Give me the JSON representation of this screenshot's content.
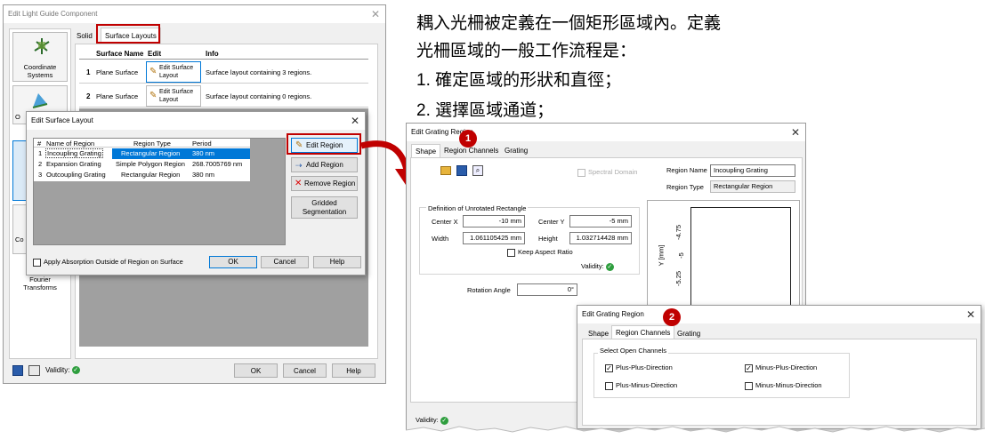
{
  "annotation": {
    "lines": [
      "耦入光柵被定義在一個矩形區域內。定義",
      "光柵區域的一般工作流程是：",
      "1. 確定區域的形狀和直徑；",
      "2. 選擇區域通道；"
    ],
    "badge1": "1",
    "badge2": "2"
  },
  "lgc": {
    "title": "Edit Light Guide Component",
    "sidebar": [
      "Coordinate Systems",
      "Fourier Transforms"
    ],
    "sidebar_partial": [
      "O",
      "Co"
    ],
    "tabs": [
      "Solid",
      "Surface Layouts"
    ],
    "table_headers": [
      "Surface Name",
      "Edit",
      "Info"
    ],
    "rows": [
      {
        "num": "1",
        "name": "Plane Surface",
        "edit": "Edit Surface Layout",
        "info": "Surface layout containing 3 regions."
      },
      {
        "num": "2",
        "name": "Plane Surface",
        "edit": "Edit Surface Layout",
        "info": "Surface layout containing 0 regions."
      }
    ],
    "validity": "Validity:",
    "ok": "OK",
    "cancel": "Cancel",
    "help": "Help"
  },
  "esl": {
    "title": "Edit Surface Layout",
    "headers": [
      "#",
      "Name of Region",
      "Region Type",
      "Period"
    ],
    "rows": [
      {
        "num": "1",
        "name": "Incoupling Grating",
        "type": "Rectangular Region",
        "period": "380 nm"
      },
      {
        "num": "2",
        "name": "Expansion Grating",
        "type": "Simple Polygon Region",
        "period": "268.7005769 nm"
      },
      {
        "num": "3",
        "name": "Outcoupling Grating",
        "type": "Rectangular Region",
        "period": "380 nm"
      }
    ],
    "buttons": [
      "Edit Region",
      "Add Region",
      "Remove Region",
      "Gridded Segmentation"
    ],
    "apply_absorption": "Apply Absorption Outside of Region on Surface",
    "ok": "OK",
    "cancel": "Cancel",
    "help": "Help"
  },
  "egr1": {
    "title": "Edit Grating Region",
    "tabs": [
      "Shape",
      "Region Channels",
      "Grating"
    ],
    "spectral": "Spectral Domain",
    "region_name_label": "Region Name",
    "region_name": "Incoupling Grating",
    "region_type_label": "Region Type",
    "region_type": "Rectangular Region",
    "group_title": "Definition of Unrotated Rectangle",
    "center_x_label": "Center X",
    "center_x": "-10 mm",
    "center_y_label": "Center Y",
    "center_y": "-5 mm",
    "width_label": "Width",
    "width": "1.061105425 mm",
    "height_label": "Height",
    "height": "1.032714428 mm",
    "keep_aspect": "Keep Aspect Ratio",
    "validity": "Validity:",
    "rotation_label": "Rotation Angle",
    "rotation": "0°",
    "plot_ylabel": "Y [mm]",
    "plot_ticks": [
      "-4.75",
      "-5",
      "-5.25"
    ]
  },
  "egr2": {
    "title": "Edit Grating Region",
    "tabs": [
      "Shape",
      "Region Channels",
      "Grating"
    ],
    "group_title": "Select Open Channels",
    "channels": [
      {
        "label": "Plus-Plus-Direction",
        "checked": true
      },
      {
        "label": "Minus-Plus-Direction",
        "checked": true
      },
      {
        "label": "Plus-Minus-Direction",
        "checked": false
      },
      {
        "label": "Minus-Minus-Direction",
        "checked": false
      }
    ]
  },
  "colors": {
    "accent_red": "#c00000",
    "selection_blue": "#0078d7",
    "valid_green": "#2e9e3e"
  }
}
